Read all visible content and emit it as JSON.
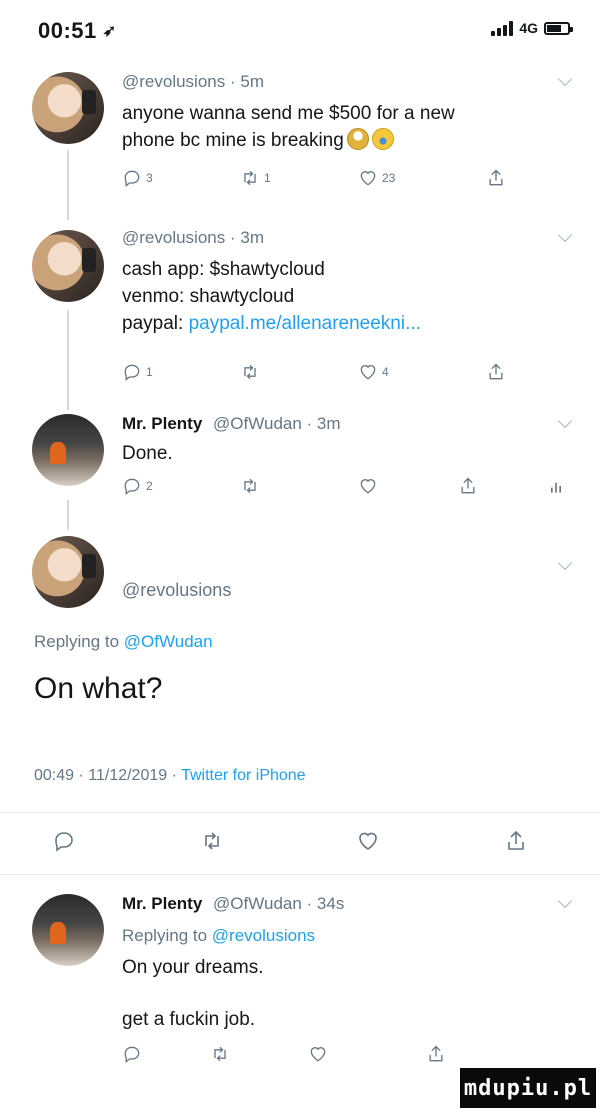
{
  "status_bar": {
    "time": "00:51",
    "location_glyph": "➶",
    "network": "4G"
  },
  "thread": [
    {
      "id": "tweet1",
      "handle": "@revolusions",
      "time": "· 5m",
      "lines": [
        "anyone wanna send me $500 for a new",
        "phone bc mine is breaking"
      ],
      "reply_count": "3",
      "retweet_count": "1",
      "like_count": "23"
    },
    {
      "id": "tweet2",
      "handle": "@revolusions",
      "time": "· 3m",
      "lines": [
        "cash app: $shawtycloud",
        "venmo: shawtycloud"
      ],
      "paypal_label": "paypal:",
      "paypal_link": "paypal.me/allenareneekni...",
      "reply_count": "1",
      "retweet_count": "",
      "like_count": "4"
    },
    {
      "id": "tweet3",
      "name": "Mr. Plenty",
      "handle": "@OfWudan",
      "time": "· 3m",
      "lines": [
        "Done."
      ],
      "reply_count": "2",
      "retweet_count": "",
      "like_count": ""
    }
  ],
  "focused": {
    "handle": "@revolusions",
    "replying_prefix": "Replying to",
    "replying_to": "@OfWudan",
    "text": "On what?",
    "timestamp": "00:49 · 11/12/2019 ·",
    "source": "Twitter for iPhone"
  },
  "reply": {
    "name": "Mr. Plenty",
    "handle": "@OfWudan",
    "time": "· 34s",
    "replying_prefix": "Replying to",
    "replying_to": "@revolusions",
    "line1": "On your dreams.",
    "line2": "get a fuckin job."
  },
  "watermark": "mdupiu.pl",
  "colors": {
    "accent": "#1da1f2",
    "muted": "#657786",
    "text": "#14171a",
    "divider": "#e6ecf0"
  },
  "icons": [
    "reply-icon",
    "retweet-icon",
    "like-icon",
    "share-icon",
    "analytics-icon",
    "chevron-down-icon"
  ]
}
